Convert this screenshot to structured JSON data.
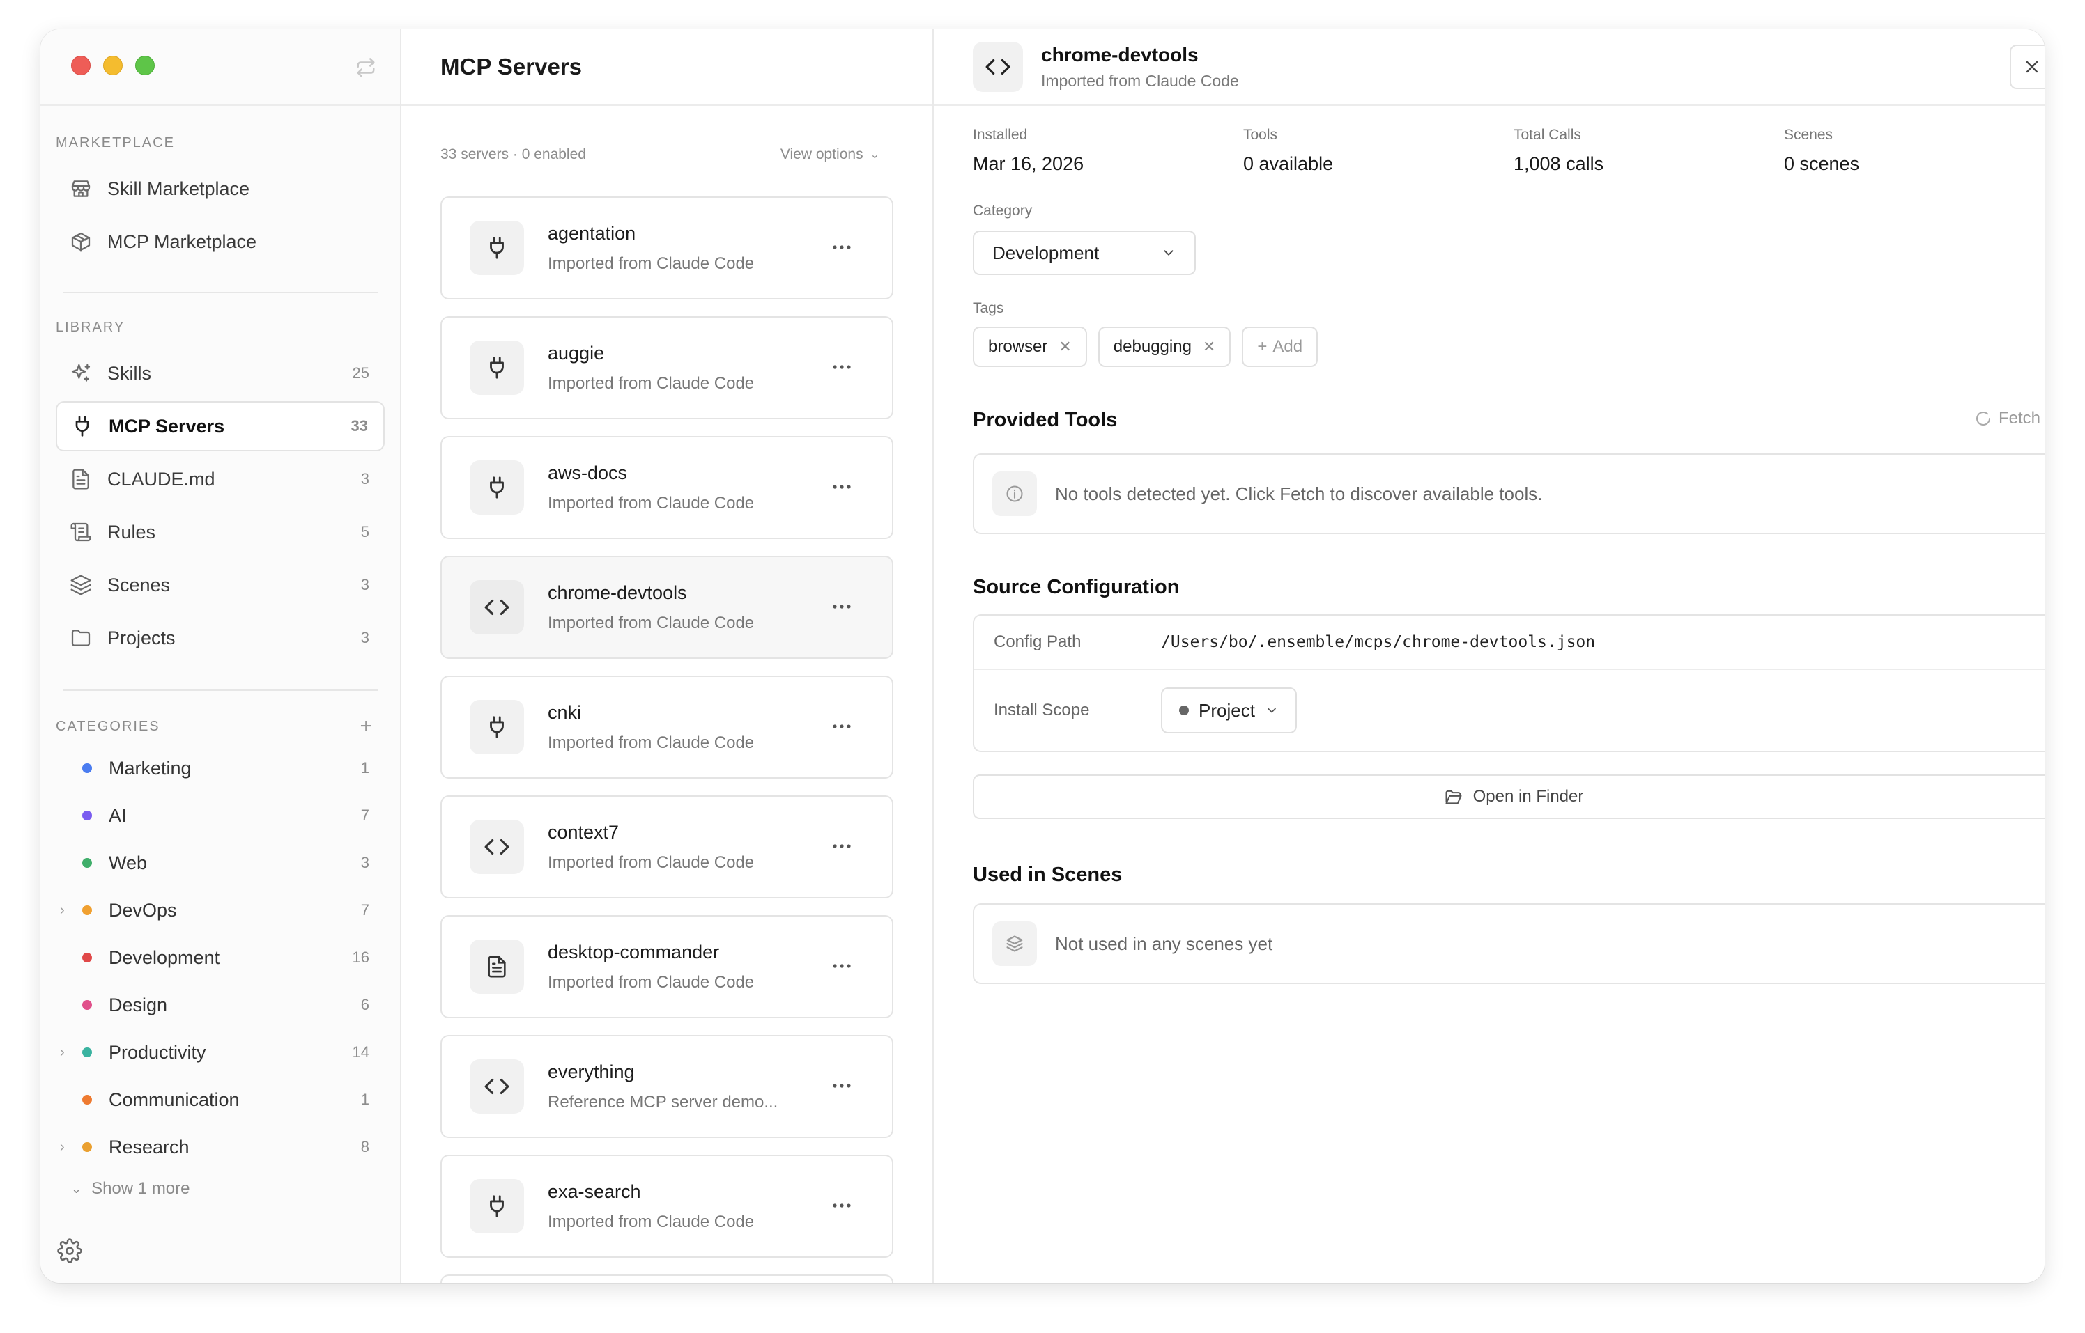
{
  "sidebar": {
    "marketplace_label": "MARKETPLACE",
    "marketplace": [
      {
        "label": "Skill Marketplace",
        "icon": "store-icon"
      },
      {
        "label": "MCP Marketplace",
        "icon": "package-icon"
      }
    ],
    "library_label": "LIBRARY",
    "library": [
      {
        "label": "Skills",
        "count": "25",
        "icon": "sparkles-icon"
      },
      {
        "label": "MCP Servers",
        "count": "33",
        "icon": "plug-icon"
      },
      {
        "label": "CLAUDE.md",
        "count": "3",
        "icon": "file-icon"
      },
      {
        "label": "Rules",
        "count": "5",
        "icon": "scroll-icon"
      },
      {
        "label": "Scenes",
        "count": "3",
        "icon": "layers-icon"
      },
      {
        "label": "Projects",
        "count": "3",
        "icon": "folder-icon"
      }
    ],
    "categories_label": "CATEGORIES",
    "categories": [
      {
        "label": "Marketing",
        "count": "1",
        "color": "#4a7cf0",
        "expandable": false
      },
      {
        "label": "AI",
        "count": "7",
        "color": "#7a5cf0",
        "expandable": false
      },
      {
        "label": "Web",
        "count": "3",
        "color": "#3fae6a",
        "expandable": false
      },
      {
        "label": "DevOps",
        "count": "7",
        "color": "#f0a030",
        "expandable": true
      },
      {
        "label": "Development",
        "count": "16",
        "color": "#e04848",
        "expandable": false
      },
      {
        "label": "Design",
        "count": "6",
        "color": "#e0508a",
        "expandable": false
      },
      {
        "label": "Productivity",
        "count": "14",
        "color": "#3ab3a0",
        "expandable": true
      },
      {
        "label": "Communication",
        "count": "1",
        "color": "#ee7a30",
        "expandable": false
      },
      {
        "label": "Research",
        "count": "8",
        "color": "#eaa030",
        "expandable": true
      }
    ],
    "show_more": "Show 1 more"
  },
  "middle": {
    "title": "MCP Servers",
    "summary": "33 servers · 0 enabled",
    "view_options": "View options",
    "servers": [
      {
        "name": "agentation",
        "desc": "Imported from Claude Code",
        "icon": "plug-icon"
      },
      {
        "name": "auggie",
        "desc": "Imported from Claude Code",
        "icon": "plug-icon"
      },
      {
        "name": "aws-docs",
        "desc": "Imported from Claude Code",
        "icon": "plug-icon"
      },
      {
        "name": "chrome-devtools",
        "desc": "Imported from Claude Code",
        "icon": "code-icon"
      },
      {
        "name": "cnki",
        "desc": "Imported from Claude Code",
        "icon": "plug-icon"
      },
      {
        "name": "context7",
        "desc": "Imported from Claude Code",
        "icon": "code-icon"
      },
      {
        "name": "desktop-commander",
        "desc": "Imported from Claude Code",
        "icon": "file-icon"
      },
      {
        "name": "everything",
        "desc": "Reference MCP server demo...",
        "icon": "code-icon"
      },
      {
        "name": "exa-search",
        "desc": "Imported from Claude Code",
        "icon": "plug-icon"
      }
    ]
  },
  "detail": {
    "name": "chrome-devtools",
    "source": "Imported from Claude Code",
    "stats": [
      {
        "label": "Installed",
        "value": "Mar 16, 2026"
      },
      {
        "label": "Tools",
        "value": "0 available"
      },
      {
        "label": "Total Calls",
        "value": "1,008 calls"
      },
      {
        "label": "Scenes",
        "value": "0 scenes"
      }
    ],
    "category_label": "Category",
    "category_value": "Development",
    "tags_label": "Tags",
    "tags": [
      "browser",
      "debugging"
    ],
    "add_tag": "Add",
    "provided_tools_title": "Provided Tools",
    "fetch_label": "Fetch",
    "no_tools_text": "No tools detected yet. Click Fetch to discover available tools.",
    "source_config_title": "Source Configuration",
    "config_path_label": "Config Path",
    "config_path_value": "/Users/bo/.ensemble/mcps/chrome-devtools.json",
    "install_scope_label": "Install Scope",
    "install_scope_value": "Project",
    "open_finder": "Open in Finder",
    "used_in_scenes_title": "Used in Scenes",
    "not_used_text": "Not used in any scenes yet"
  }
}
